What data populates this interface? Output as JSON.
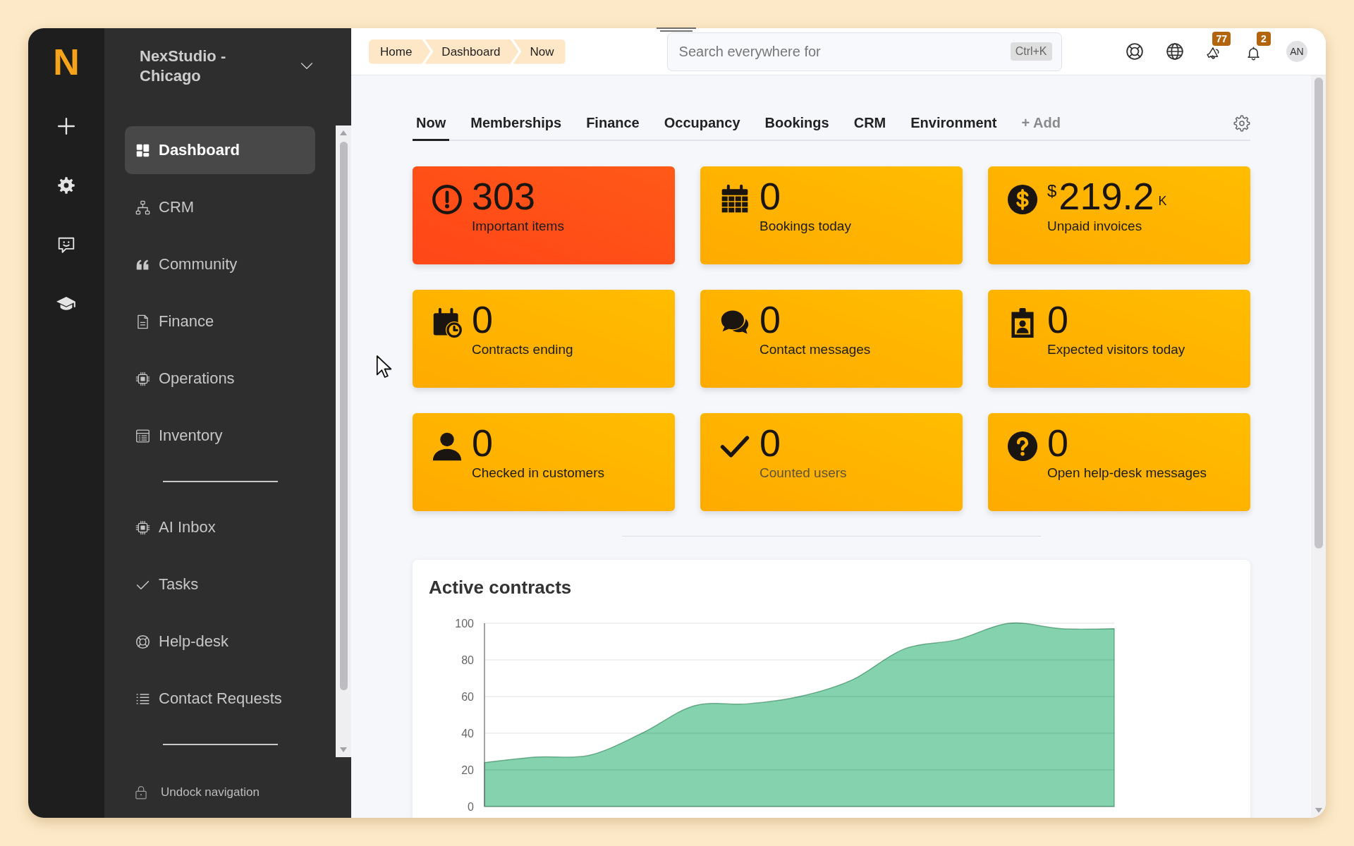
{
  "app": {
    "logo": "N"
  },
  "workspace": {
    "name": "NexStudio - Chicago"
  },
  "sidebar": {
    "sections": [
      {
        "items": [
          {
            "label": "Dashboard",
            "selected": true
          },
          {
            "label": "CRM",
            "selected": false
          },
          {
            "label": "Community",
            "selected": false
          },
          {
            "label": "Finance",
            "selected": false
          },
          {
            "label": "Operations",
            "selected": false
          },
          {
            "label": "Inventory",
            "selected": false
          }
        ]
      },
      {
        "items": [
          {
            "label": "AI Inbox",
            "selected": false
          },
          {
            "label": "Tasks",
            "selected": false
          },
          {
            "label": "Help-desk",
            "selected": false
          },
          {
            "label": "Contact Requests",
            "selected": false
          }
        ]
      }
    ],
    "footer_link": "Undock navigation"
  },
  "breadcrumb": [
    "Home",
    "Dashboard",
    "Now"
  ],
  "search": {
    "placeholder": "Search everywhere for",
    "shortcut": "Ctrl+K"
  },
  "header_actions": {
    "announcements_count": "77",
    "notifications_count": "2",
    "avatar_initials": "AN"
  },
  "tabs": [
    {
      "label": "Now",
      "selected": true
    },
    {
      "label": "Memberships",
      "selected": false
    },
    {
      "label": "Finance",
      "selected": false
    },
    {
      "label": "Occupancy",
      "selected": false
    },
    {
      "label": "Bookings",
      "selected": false
    },
    {
      "label": "CRM",
      "selected": false
    },
    {
      "label": "Environment",
      "selected": false
    }
  ],
  "add_tab": "+ Add",
  "stat_cards": [
    {
      "value": "303",
      "label": "Important items",
      "color": "#ff3f1c",
      "dimmed": false
    },
    {
      "value": "0",
      "label": "Bookings today",
      "color": "#ffb600",
      "dimmed": false
    },
    {
      "prefix": "$",
      "value": "219.2",
      "suffix": "K",
      "label": "Unpaid invoices",
      "color": "#ffb600",
      "dimmed": false
    },
    {
      "value": "0",
      "label": "Contracts ending",
      "color": "#ffb600",
      "dimmed": false
    },
    {
      "value": "0",
      "label": "Contact messages",
      "color": "#ffb600",
      "dimmed": false
    },
    {
      "value": "0",
      "label": "Expected visitors today",
      "color": "#ffb600",
      "dimmed": false
    },
    {
      "value": "0",
      "label": "Checked in customers",
      "color": "#ffb600",
      "dimmed": false
    },
    {
      "value": "0",
      "label": "Counted users",
      "color": "#ffb600",
      "dimmed": true
    },
    {
      "value": "0",
      "label": "Open help-desk messages",
      "color": "#ffb600",
      "dimmed": false
    }
  ],
  "active_contracts": {
    "chart_data": {
      "type": "area",
      "title": "Active contracts",
      "series": [
        {
          "color": "#84d3ae",
          "values": [
            24,
            27,
            28,
            40,
            55,
            56,
            60,
            69,
            86,
            91,
            100,
            97,
            97
          ]
        }
      ],
      "ylim": [
        0,
        100
      ],
      "yticks": [
        0,
        20,
        40,
        60,
        80,
        100
      ],
      "grid": true
    }
  }
}
